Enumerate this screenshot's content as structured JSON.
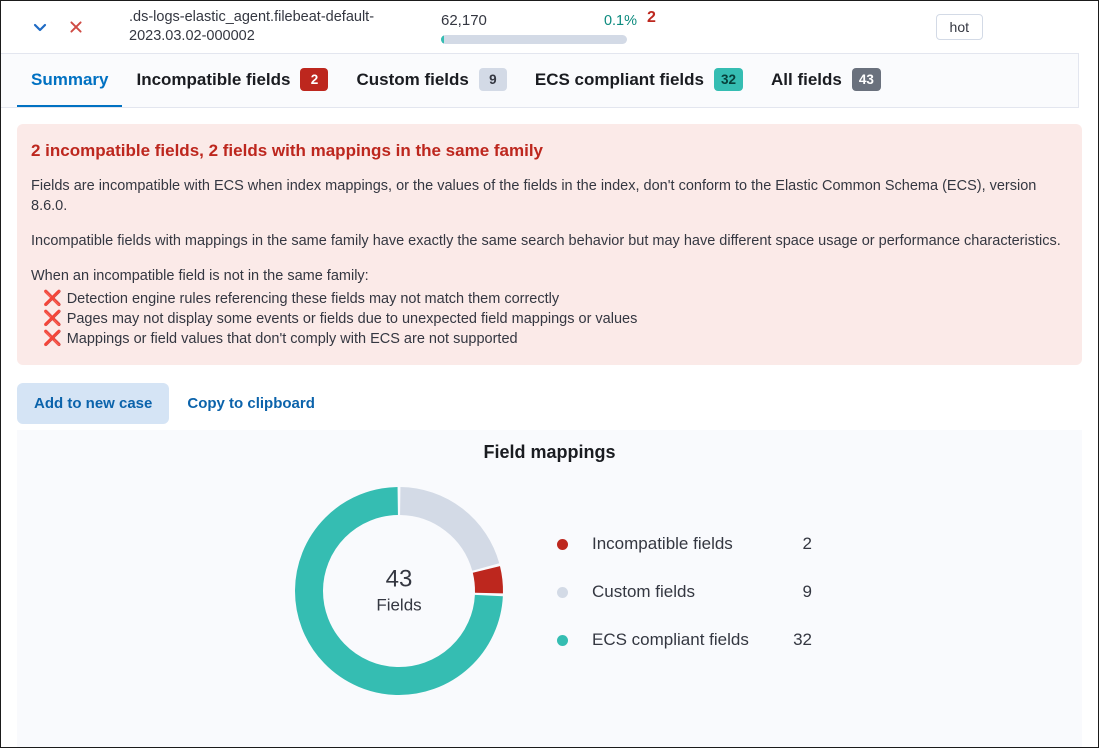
{
  "header": {
    "collapse_icon": "chevron-down-icon",
    "remove_icon": "close-x-icon",
    "index_name": ".ds-logs-elastic_agent.filebeat-default-2023.03.02-000002",
    "doc_count": "62,170",
    "doc_percent": "0.1%",
    "incompatible_count": "2",
    "ilm_phase": "hot"
  },
  "tabs": [
    {
      "label": "Summary",
      "badge": null,
      "badge_style": null,
      "active": true
    },
    {
      "label": "Incompatible fields",
      "badge": "2",
      "badge_style": "badge-danger",
      "active": false
    },
    {
      "label": "Custom fields",
      "badge": "9",
      "badge_style": "badge-subdued",
      "active": false
    },
    {
      "label": "ECS compliant fields",
      "badge": "32",
      "badge_style": "badge-teal",
      "active": false
    },
    {
      "label": "All fields",
      "badge": "43",
      "badge_style": "badge-slate",
      "active": false
    }
  ],
  "callout": {
    "title": "2 incompatible fields, 2 fields with mappings in the same family",
    "paragraph_1": "Fields are incompatible with ECS when index mappings, or the values of the fields in the index, don't conform to the Elastic Common Schema (ECS), version 8.6.0.",
    "paragraph_2": "Incompatible fields with mappings in the same family have exactly the same search behavior but may have different space usage or performance characteristics.",
    "paragraph_3": "When an incompatible field is not in the same family:",
    "bullets": [
      "Detection engine rules referencing these fields may not match them correctly",
      "Pages may not display some events or fields due to unexpected field mappings or values",
      "Mappings or field values that don't comply with ECS are not supported"
    ],
    "bullet_icon": "x-mark-icon"
  },
  "actions": {
    "add_to_case": "Add to new case",
    "copy_to_clipboard": "Copy to clipboard"
  },
  "chart_data": {
    "type": "pie",
    "title": "Field mappings",
    "center_value": "43",
    "center_label": "Fields",
    "total": 43,
    "categories": [
      "Incompatible fields",
      "Custom fields",
      "ECS compliant fields"
    ],
    "values": [
      2,
      9,
      32
    ],
    "colors": [
      "#bd271e",
      "#d3dae6",
      "#35bdb2"
    ],
    "draw_order": [
      "Custom fields",
      "Incompatible fields",
      "ECS compliant fields"
    ],
    "start_angle_deg": 0,
    "legend_position": "right",
    "grid": false
  },
  "colors": {
    "danger": "#bd271e",
    "teal": "#35bdb2",
    "subdued": "#d3dae6",
    "link": "#0b63ab",
    "active_tab": "#0071c2",
    "callout_bg": "#fbeae8"
  }
}
